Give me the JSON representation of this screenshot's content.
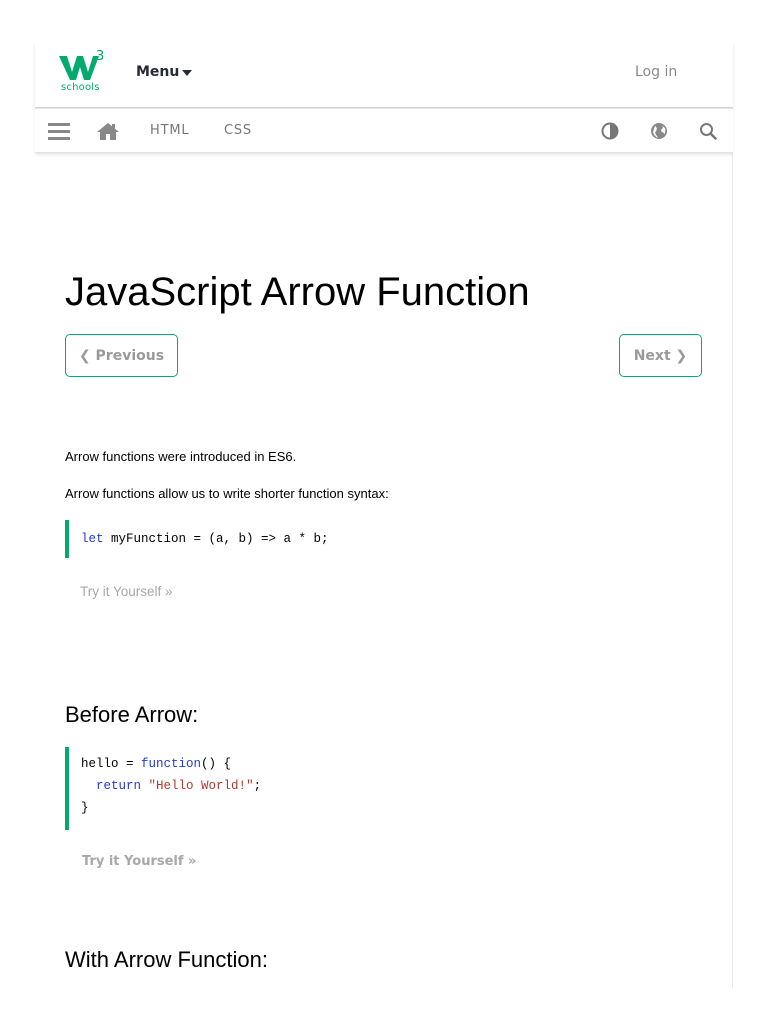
{
  "header": {
    "logo_sup": "3",
    "logo_text": "schools",
    "menu_label": "Menu",
    "login_label": "Log in"
  },
  "navbar": {
    "links": [
      "HTML",
      "CSS"
    ],
    "icons": [
      "hamburger-icon",
      "home-icon",
      "contrast-icon",
      "globe-icon",
      "search-icon"
    ]
  },
  "main": {
    "title": "JavaScript Arrow Function",
    "prev_label": "❮ Previous",
    "next_label": "Next ❯",
    "intro": [
      "Arrow functions were introduced in ES6.",
      "Arrow functions allow us to write shorter function syntax:"
    ],
    "example1": {
      "kw": "let",
      "rest": " myFunction = (a, b) => a * b;"
    },
    "try1": "Try it Yourself »",
    "heading_before": "Before Arrow:",
    "example2": {
      "l1_a": "hello = ",
      "l1_kw": "function",
      "l1_b": "() {",
      "l2_indent": "  ",
      "l2_kw": "return",
      "l2_sp": " ",
      "l2_str": "\"Hello World!\"",
      "l2_end": ";",
      "l3": "}"
    },
    "try2": "Try it Yourself »",
    "heading_with": "With Arrow Function:"
  },
  "colors": {
    "brand": "#04AA6D",
    "keyword": "#1f3bd8",
    "string": "#b03a2e"
  }
}
